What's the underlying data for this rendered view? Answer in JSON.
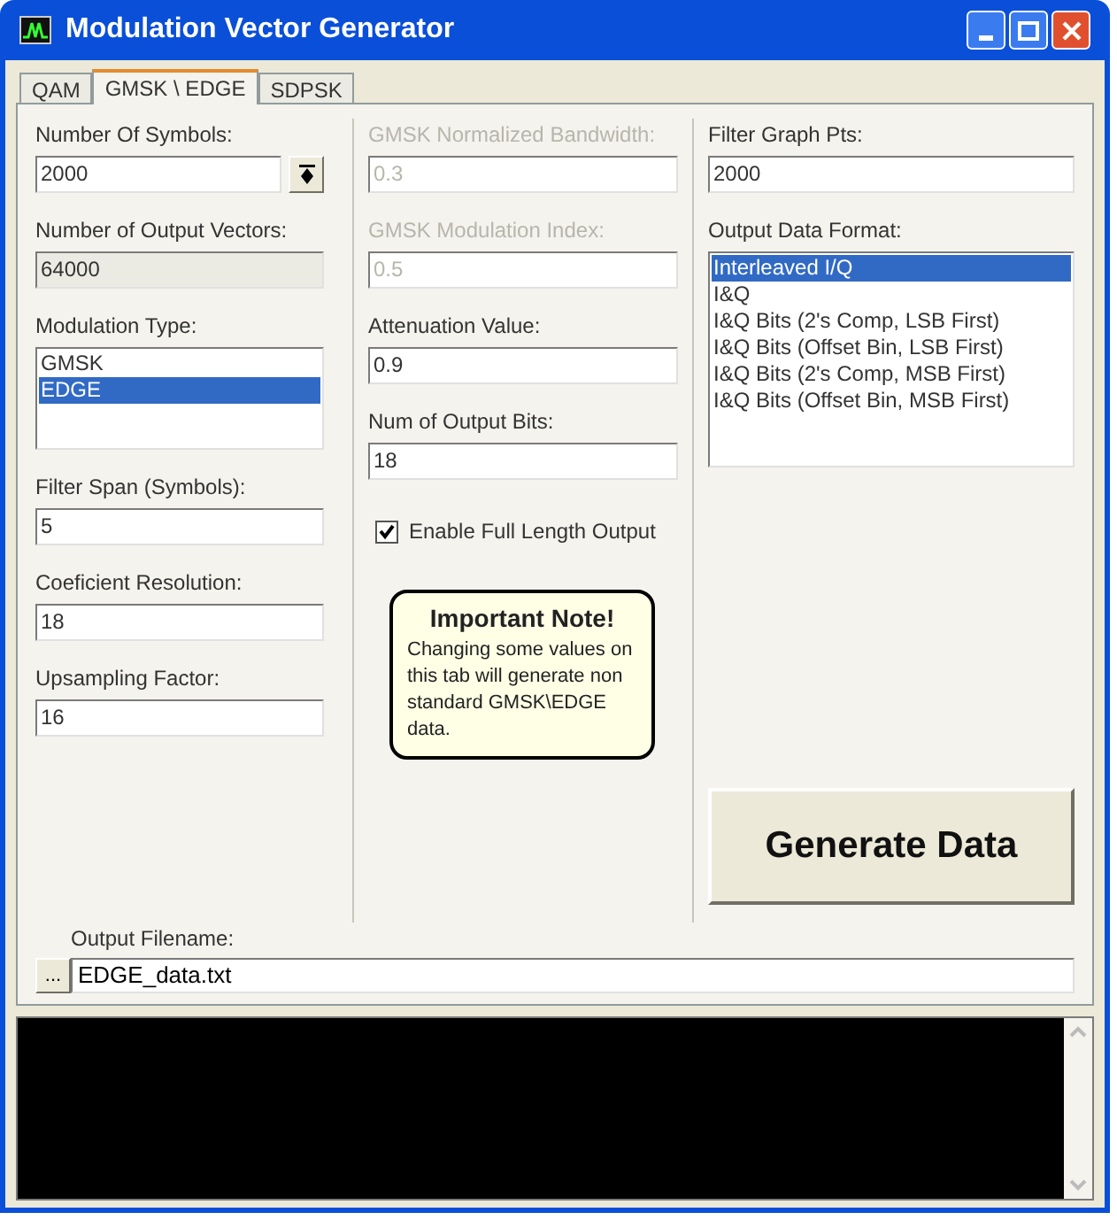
{
  "window": {
    "title": "Modulation Vector Generator"
  },
  "tabs": [
    {
      "label": "QAM",
      "selected": false
    },
    {
      "label": "GMSK \\ EDGE",
      "selected": true
    },
    {
      "label": "SDPSK",
      "selected": false
    }
  ],
  "left_column": [
    {
      "kind": "spin",
      "label": "Number Of Symbols:",
      "value": "2000",
      "disabled": false
    },
    {
      "kind": "readonly",
      "label": "Number of Output Vectors:",
      "value": "64000",
      "disabled": false
    },
    {
      "kind": "list",
      "label": "Modulation Type:",
      "items": [
        {
          "label": "GMSK",
          "selected": false
        },
        {
          "label": "EDGE",
          "selected": true
        }
      ]
    },
    {
      "kind": "field",
      "label": "Filter Span (Symbols):",
      "value": "5",
      "disabled": false
    },
    {
      "kind": "field",
      "label": "Coeficient Resolution:",
      "value": "18",
      "disabled": false
    },
    {
      "kind": "field",
      "label": "Upsampling Factor:",
      "value": "16",
      "disabled": false
    }
  ],
  "middle_column": [
    {
      "kind": "field",
      "label": "GMSK Normalized Bandwidth:",
      "value": "0.3",
      "disabled": true
    },
    {
      "kind": "field",
      "label": "GMSK Modulation Index:",
      "value": "0.5",
      "disabled": true
    },
    {
      "kind": "field",
      "label": "Attenuation Value:",
      "value": "0.9",
      "disabled": false
    },
    {
      "kind": "field",
      "label": "Num of Output Bits:",
      "value": "18",
      "disabled": false
    },
    {
      "kind": "checkbox",
      "label": "Enable Full Length Output",
      "checked": true
    }
  ],
  "note": {
    "title": "Important Note!",
    "text": "Changing some values on this tab will generate non standard GMSK\\EDGE data."
  },
  "right_column": [
    {
      "kind": "field",
      "label": "Filter Graph Pts:",
      "value": "2000",
      "disabled": false
    },
    {
      "kind": "list",
      "label": "Output Data Format:",
      "items": [
        {
          "label": "Interleaved I/Q",
          "selected": true
        },
        {
          "label": "I&Q",
          "selected": false
        },
        {
          "label": "I&Q Bits (2's Comp, LSB First)",
          "selected": false
        },
        {
          "label": "I&Q Bits (Offset Bin, LSB First)",
          "selected": false
        },
        {
          "label": "I&Q Bits (2's Comp, MSB First)",
          "selected": false
        },
        {
          "label": "I&Q Bits (Offset Bin, MSB First)",
          "selected": false
        }
      ]
    }
  ],
  "generate_button": "Generate Data",
  "output_filename": {
    "label": "Output Filename:",
    "browse": "...",
    "value": "EDGE_data.txt"
  }
}
